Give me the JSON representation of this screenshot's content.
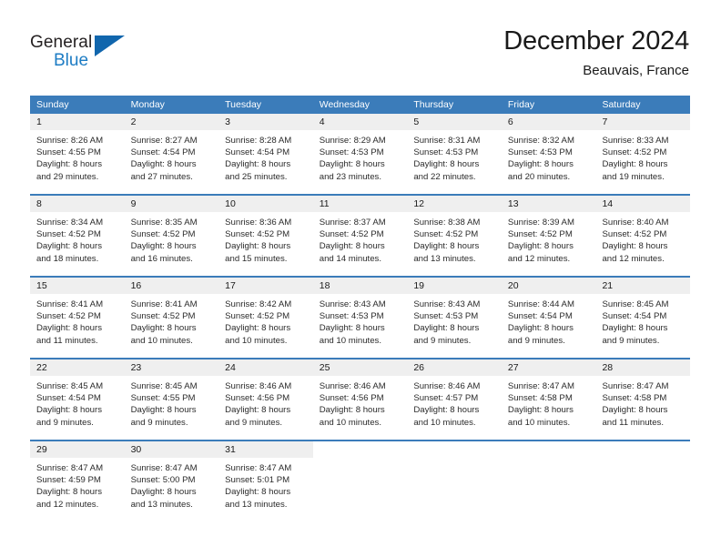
{
  "brand": {
    "name_part1": "General",
    "name_part2": "Blue",
    "triangle_color": "#1166ad",
    "blue_text_color": "#1d7cc4"
  },
  "header": {
    "title": "December 2024",
    "location": "Beauvais, France"
  },
  "theme": {
    "header_blue": "#3b7cba",
    "date_band_gray": "#efefef",
    "rule_blue": "#3b7cba",
    "text_color": "#2b2b2b"
  },
  "calendar": {
    "weekday_headers": [
      "Sunday",
      "Monday",
      "Tuesday",
      "Wednesday",
      "Thursday",
      "Friday",
      "Saturday"
    ],
    "weeks": [
      [
        {
          "day": "1",
          "lines": [
            "Sunrise: 8:26 AM",
            "Sunset: 4:55 PM",
            "Daylight: 8 hours",
            "and 29 minutes."
          ]
        },
        {
          "day": "2",
          "lines": [
            "Sunrise: 8:27 AM",
            "Sunset: 4:54 PM",
            "Daylight: 8 hours",
            "and 27 minutes."
          ]
        },
        {
          "day": "3",
          "lines": [
            "Sunrise: 8:28 AM",
            "Sunset: 4:54 PM",
            "Daylight: 8 hours",
            "and 25 minutes."
          ]
        },
        {
          "day": "4",
          "lines": [
            "Sunrise: 8:29 AM",
            "Sunset: 4:53 PM",
            "Daylight: 8 hours",
            "and 23 minutes."
          ]
        },
        {
          "day": "5",
          "lines": [
            "Sunrise: 8:31 AM",
            "Sunset: 4:53 PM",
            "Daylight: 8 hours",
            "and 22 minutes."
          ]
        },
        {
          "day": "6",
          "lines": [
            "Sunrise: 8:32 AM",
            "Sunset: 4:53 PM",
            "Daylight: 8 hours",
            "and 20 minutes."
          ]
        },
        {
          "day": "7",
          "lines": [
            "Sunrise: 8:33 AM",
            "Sunset: 4:52 PM",
            "Daylight: 8 hours",
            "and 19 minutes."
          ]
        }
      ],
      [
        {
          "day": "8",
          "lines": [
            "Sunrise: 8:34 AM",
            "Sunset: 4:52 PM",
            "Daylight: 8 hours",
            "and 18 minutes."
          ]
        },
        {
          "day": "9",
          "lines": [
            "Sunrise: 8:35 AM",
            "Sunset: 4:52 PM",
            "Daylight: 8 hours",
            "and 16 minutes."
          ]
        },
        {
          "day": "10",
          "lines": [
            "Sunrise: 8:36 AM",
            "Sunset: 4:52 PM",
            "Daylight: 8 hours",
            "and 15 minutes."
          ]
        },
        {
          "day": "11",
          "lines": [
            "Sunrise: 8:37 AM",
            "Sunset: 4:52 PM",
            "Daylight: 8 hours",
            "and 14 minutes."
          ]
        },
        {
          "day": "12",
          "lines": [
            "Sunrise: 8:38 AM",
            "Sunset: 4:52 PM",
            "Daylight: 8 hours",
            "and 13 minutes."
          ]
        },
        {
          "day": "13",
          "lines": [
            "Sunrise: 8:39 AM",
            "Sunset: 4:52 PM",
            "Daylight: 8 hours",
            "and 12 minutes."
          ]
        },
        {
          "day": "14",
          "lines": [
            "Sunrise: 8:40 AM",
            "Sunset: 4:52 PM",
            "Daylight: 8 hours",
            "and 12 minutes."
          ]
        }
      ],
      [
        {
          "day": "15",
          "lines": [
            "Sunrise: 8:41 AM",
            "Sunset: 4:52 PM",
            "Daylight: 8 hours",
            "and 11 minutes."
          ]
        },
        {
          "day": "16",
          "lines": [
            "Sunrise: 8:41 AM",
            "Sunset: 4:52 PM",
            "Daylight: 8 hours",
            "and 10 minutes."
          ]
        },
        {
          "day": "17",
          "lines": [
            "Sunrise: 8:42 AM",
            "Sunset: 4:52 PM",
            "Daylight: 8 hours",
            "and 10 minutes."
          ]
        },
        {
          "day": "18",
          "lines": [
            "Sunrise: 8:43 AM",
            "Sunset: 4:53 PM",
            "Daylight: 8 hours",
            "and 10 minutes."
          ]
        },
        {
          "day": "19",
          "lines": [
            "Sunrise: 8:43 AM",
            "Sunset: 4:53 PM",
            "Daylight: 8 hours",
            "and 9 minutes."
          ]
        },
        {
          "day": "20",
          "lines": [
            "Sunrise: 8:44 AM",
            "Sunset: 4:54 PM",
            "Daylight: 8 hours",
            "and 9 minutes."
          ]
        },
        {
          "day": "21",
          "lines": [
            "Sunrise: 8:45 AM",
            "Sunset: 4:54 PM",
            "Daylight: 8 hours",
            "and 9 minutes."
          ]
        }
      ],
      [
        {
          "day": "22",
          "lines": [
            "Sunrise: 8:45 AM",
            "Sunset: 4:54 PM",
            "Daylight: 8 hours",
            "and 9 minutes."
          ]
        },
        {
          "day": "23",
          "lines": [
            "Sunrise: 8:45 AM",
            "Sunset: 4:55 PM",
            "Daylight: 8 hours",
            "and 9 minutes."
          ]
        },
        {
          "day": "24",
          "lines": [
            "Sunrise: 8:46 AM",
            "Sunset: 4:56 PM",
            "Daylight: 8 hours",
            "and 9 minutes."
          ]
        },
        {
          "day": "25",
          "lines": [
            "Sunrise: 8:46 AM",
            "Sunset: 4:56 PM",
            "Daylight: 8 hours",
            "and 10 minutes."
          ]
        },
        {
          "day": "26",
          "lines": [
            "Sunrise: 8:46 AM",
            "Sunset: 4:57 PM",
            "Daylight: 8 hours",
            "and 10 minutes."
          ]
        },
        {
          "day": "27",
          "lines": [
            "Sunrise: 8:47 AM",
            "Sunset: 4:58 PM",
            "Daylight: 8 hours",
            "and 10 minutes."
          ]
        },
        {
          "day": "28",
          "lines": [
            "Sunrise: 8:47 AM",
            "Sunset: 4:58 PM",
            "Daylight: 8 hours",
            "and 11 minutes."
          ]
        }
      ],
      [
        {
          "day": "29",
          "lines": [
            "Sunrise: 8:47 AM",
            "Sunset: 4:59 PM",
            "Daylight: 8 hours",
            "and 12 minutes."
          ]
        },
        {
          "day": "30",
          "lines": [
            "Sunrise: 8:47 AM",
            "Sunset: 5:00 PM",
            "Daylight: 8 hours",
            "and 13 minutes."
          ]
        },
        {
          "day": "31",
          "lines": [
            "Sunrise: 8:47 AM",
            "Sunset: 5:01 PM",
            "Daylight: 8 hours",
            "and 13 minutes."
          ]
        },
        {
          "day": "",
          "lines": []
        },
        {
          "day": "",
          "lines": []
        },
        {
          "day": "",
          "lines": []
        },
        {
          "day": "",
          "lines": []
        }
      ]
    ]
  }
}
